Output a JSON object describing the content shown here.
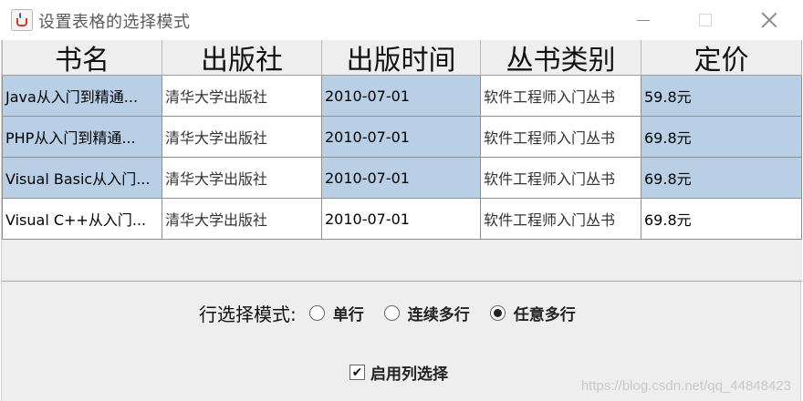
{
  "window": {
    "title": "设置表格的选择模式",
    "icon": "java-coffee-icon"
  },
  "table": {
    "columns": [
      "书名",
      "出版社",
      "出版时间",
      "丛书类别",
      "定价"
    ],
    "rows": [
      {
        "cells": [
          "Java从入门到精通...",
          "清华大学出版社",
          "2010-07-01",
          "软件工程师入门丛书",
          "59.8元"
        ],
        "selected": [
          true,
          false,
          true,
          false,
          true
        ]
      },
      {
        "cells": [
          "PHP从入门到精通...",
          "清华大学出版社",
          "2010-07-01",
          "软件工程师入门丛书",
          "69.8元"
        ],
        "selected": [
          true,
          false,
          true,
          false,
          true
        ]
      },
      {
        "cells": [
          "Visual Basic从入门...",
          "清华大学出版社",
          "2010-07-01",
          "软件工程师入门丛书",
          "69.8元"
        ],
        "selected": [
          true,
          false,
          true,
          false,
          true
        ]
      },
      {
        "cells": [
          "Visual C++从入门...",
          "清华大学出版社",
          "2010-07-01",
          "软件工程师入门丛书",
          "69.8元"
        ],
        "selected": [
          false,
          false,
          false,
          false,
          false
        ]
      }
    ]
  },
  "selection_mode": {
    "label": "行选择模式:",
    "options": [
      {
        "label": "单行",
        "checked": false
      },
      {
        "label": "连续多行",
        "checked": false
      },
      {
        "label": "任意多行",
        "checked": true
      }
    ]
  },
  "column_selection": {
    "label": "启用列选择",
    "checked": true
  },
  "watermark": "https://blog.csdn.net/qq_44848423",
  "colors": {
    "selected_cell": "#b8cfe5",
    "background": "#eeeeee"
  }
}
